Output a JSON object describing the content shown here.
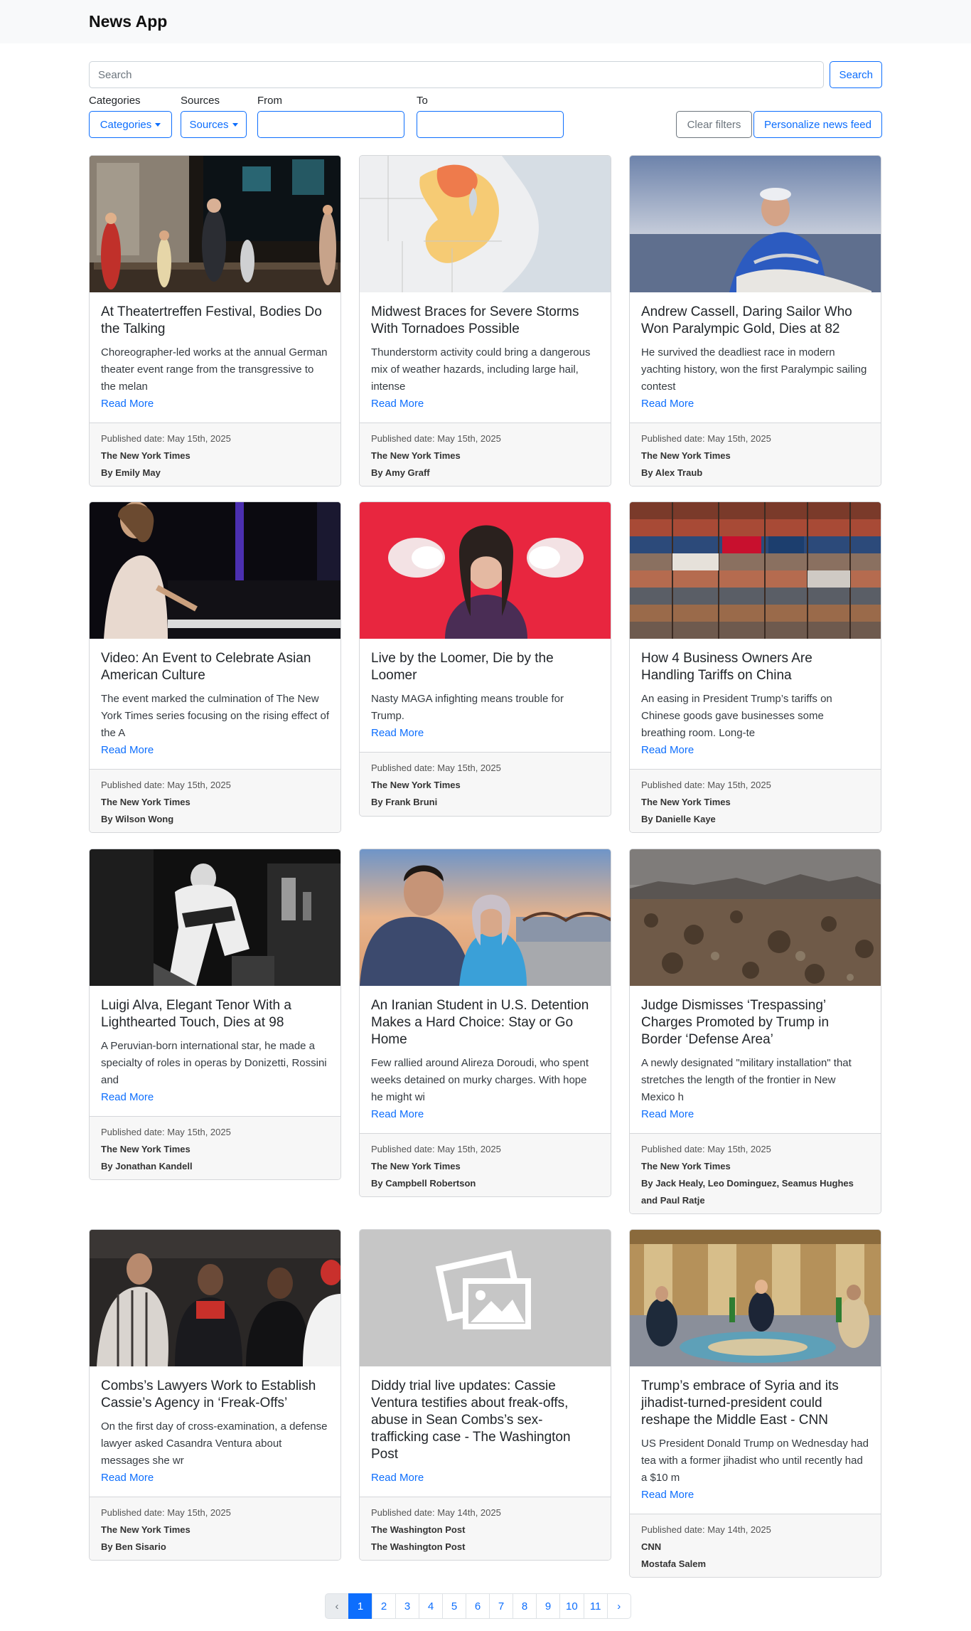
{
  "app": {
    "title": "News App"
  },
  "search": {
    "placeholder": "Search",
    "button": "Search"
  },
  "filters": {
    "categories_label": "Categories",
    "categories_button": "Categories",
    "sources_label": "Sources",
    "sources_button": "Sources",
    "from_label": "From",
    "to_label": "To",
    "clear_button": "Clear filters",
    "personalize_button": "Personalize news feed"
  },
  "articles": [
    {
      "title": "At Theatertreffen Festival, Bodies Do the Talking",
      "summary": "Choreographer-led works at the annual German theater event range from the transgressive to the melan",
      "read_more": "Read More",
      "published": "Published date: May 15th, 2025",
      "source": "The New York Times",
      "author": "By Emily May"
    },
    {
      "title": "Midwest Braces for Severe Storms With Tornadoes Possible",
      "summary": "Thunderstorm activity could bring a dangerous mix of weather hazards, including large hail, intense",
      "read_more": "Read More",
      "published": "Published date: May 15th, 2025",
      "source": "The New York Times",
      "author": "By Amy Graff"
    },
    {
      "title": "Andrew Cassell, Daring Sailor Who Won Paralympic Gold, Dies at 82",
      "summary": "He survived the deadliest race in modern yachting history, won the first Paralympic sailing contest",
      "read_more": "Read More",
      "published": "Published date: May 15th, 2025",
      "source": "The New York Times",
      "author": "By Alex Traub"
    },
    {
      "title": "Video: An Event to Celebrate Asian American Culture",
      "summary": "The event marked the culmination of The New York Times series focusing on the rising effect of the A",
      "read_more": "Read More",
      "published": "Published date: May 15th, 2025",
      "source": "The New York Times",
      "author": "By Wilson Wong"
    },
    {
      "title": "Live by the Loomer, Die by the Loomer",
      "summary": "Nasty MAGA infighting means trouble for Trump.",
      "read_more": "Read More",
      "published": "Published date: May 15th, 2025",
      "source": "The New York Times",
      "author": "By Frank Bruni"
    },
    {
      "title": "How 4 Business Owners Are Handling Tariffs on China",
      "summary": "An easing in President Trump’s tariffs on Chinese goods gave businesses some breathing room. Long-te",
      "read_more": "Read More",
      "published": "Published date: May 15th, 2025",
      "source": "The New York Times",
      "author": "By Danielle Kaye"
    },
    {
      "title": "Luigi Alva, Elegant Tenor With a Lighthearted Touch, Dies at 98",
      "summary": "A Peruvian-born international star, he made a specialty of roles in operas by Donizetti, Rossini and",
      "read_more": "Read More",
      "published": "Published date: May 15th, 2025",
      "source": "The New York Times",
      "author": "By Jonathan Kandell"
    },
    {
      "title": "An Iranian Student in U.S. Detention Makes a Hard Choice: Stay or Go Home",
      "summary": "Few rallied around Alireza Doroudi, who spent weeks detained on murky charges. With hope he might wi",
      "read_more": "Read More",
      "published": "Published date: May 15th, 2025",
      "source": "The New York Times",
      "author": "By Campbell Robertson"
    },
    {
      "title": "Judge Dismisses ‘Trespassing’ Charges Promoted by Trump in Border ‘Defense Area’",
      "summary": "A newly designated \"military installation\" that stretches the length of the frontier in New Mexico h",
      "read_more": "Read More",
      "published": "Published date: May 15th, 2025",
      "source": "The New York Times",
      "author": "By Jack Healy, Leo Dominguez, Seamus Hughes and Paul Ratje"
    },
    {
      "title": "Combs’s Lawyers Work to Establish Cassie’s Agency in ‘Freak-Offs’",
      "summary": "On the first day of cross-examination, a defense lawyer asked Casandra Ventura about messages she wr",
      "read_more": "Read More",
      "published": "Published date: May 15th, 2025",
      "source": "The New York Times",
      "author": "By Ben Sisario"
    },
    {
      "title": "Diddy trial live updates: Cassie Ventura testifies about freak-offs, abuse in Sean Combs’s sex-trafficking case - The Washington Post",
      "summary": "",
      "read_more": "Read More",
      "published": "Published date: May 14th, 2025",
      "source": "The Washington Post",
      "author": "The Washington Post"
    },
    {
      "title": "Trump’s embrace of Syria and its jihadist-turned-president could reshape the Middle East - CNN",
      "summary": "US President Donald Trump on Wednesday had tea with a former jihadist who until recently had a $10 m",
      "read_more": "Read More",
      "published": "Published date: May 14th, 2025",
      "source": "CNN",
      "author": "Mostafa Salem"
    }
  ],
  "pagination": {
    "prev": "‹",
    "pages": [
      "1",
      "2",
      "3",
      "4",
      "5",
      "6",
      "7",
      "8",
      "9",
      "10",
      "11"
    ],
    "next": "›",
    "current": "1"
  },
  "colors": {
    "accent": "#0d6efd",
    "navbar_bg": "#f8f9fa",
    "footer_bg": "#f7f7f7"
  }
}
